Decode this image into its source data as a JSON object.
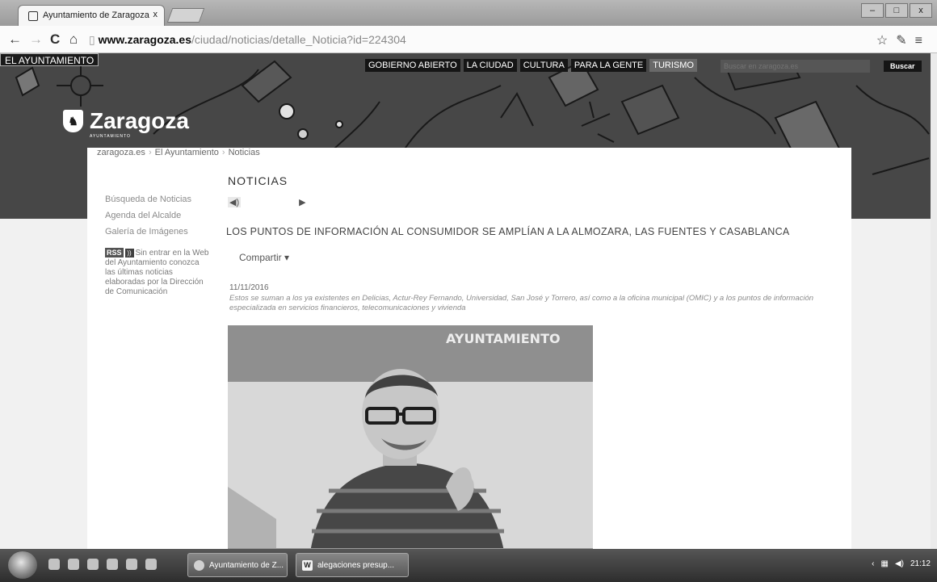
{
  "browser": {
    "tab_title": "Ayuntamiento de Zaragoza",
    "tab_close": "x",
    "window_controls": {
      "minimize": "–",
      "maximize": "□",
      "close": "x"
    },
    "url_domain": "www.zaragoza.es",
    "url_path": "/ciudad/noticias/detalle_Noticia?id=224304"
  },
  "site": {
    "ayuntamiento_link": "EL AYUNTAMIENTO",
    "top_nav": [
      {
        "label": "GOBIERNO ABIERTO"
      },
      {
        "label": "LA CIUDAD"
      },
      {
        "label": "CULTURA"
      },
      {
        "label": "PARA LA GENTE"
      },
      {
        "label": "TURISMO"
      }
    ],
    "search_placeholder": "Buscar en zaragoza.es",
    "search_button": "Buscar",
    "logo_text": "Zaragoza",
    "logo_subtext": "AYUNTAMIENTO"
  },
  "breadcrumb": [
    "zaragoza.es",
    "El Ayuntamiento",
    "Noticias"
  ],
  "sidebar": {
    "links": [
      "Búsqueda de Noticias",
      "Agenda del Alcalde",
      "Galería de Imágenes"
    ],
    "rss_badge": "RSS",
    "rss_text": "Sin entrar en la Web del Ayuntamiento conozca las últimas noticias elaboradas por la Dirección de Comunicación"
  },
  "article": {
    "section_title": "NOTICIAS",
    "headline": "LOS PUNTOS DE INFORMACIÓN AL CONSUMIDOR SE AMPLÍAN A LA ALMOZARA, LAS FUENTES Y CASABLANCA",
    "share_label": "Compartir ▾",
    "date": "11/11/2016",
    "summary": "Estos se suman a los ya existentes en Delicias, Actur-Rey Fernando, Universidad, San José y Torrero, así como a la oficina municipal (OMIC) y a los puntos de información especializada en servicios financieros, telecomunicaciones y vivienda",
    "photo_backdrop_text": "AYUNTAMIENTO"
  },
  "taskbar": {
    "tasks": [
      {
        "label": "Ayuntamiento de Z..."
      },
      {
        "label": "alegaciones presup..."
      }
    ],
    "clock": "21:12"
  }
}
